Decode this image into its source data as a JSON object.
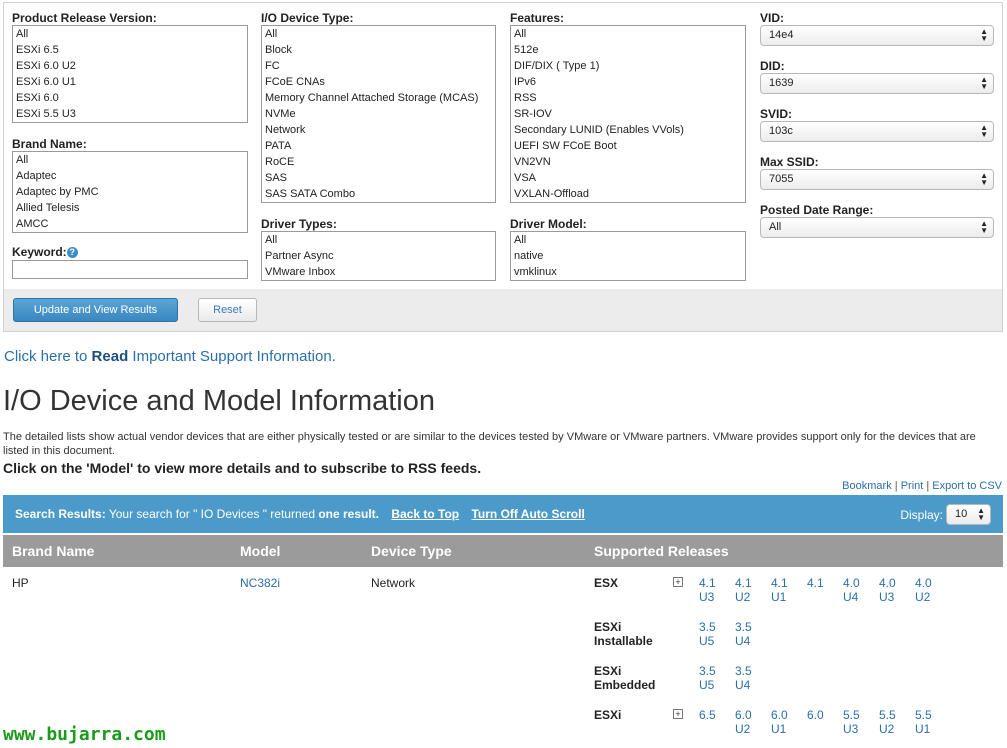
{
  "filters": {
    "product_release": {
      "label": "Product Release Version:",
      "options": [
        "All",
        "ESXi 6.5",
        "ESXi 6.0 U2",
        "ESXi 6.0 U1",
        "ESXi 6.0",
        "ESXi 5.5 U3"
      ]
    },
    "brand_name": {
      "label": "Brand Name:",
      "options": [
        "All",
        "Adaptec",
        "Adaptec by PMC",
        "Allied Telesis",
        "AMCC"
      ]
    },
    "keyword": {
      "label": "Keyword:",
      "help_icon": "help-icon",
      "value": ""
    },
    "io_device_type": {
      "label": "I/O Device Type:",
      "options": [
        "All",
        "Block",
        "FC",
        "FCoE CNAs",
        "Memory Channel Attached Storage (MCAS)",
        "NVMe",
        "Network",
        "PATA",
        "RoCE",
        "SAS",
        "SAS SATA Combo"
      ]
    },
    "driver_types": {
      "label": "Driver Types:",
      "options": [
        "All",
        "Partner Async",
        "VMware Inbox"
      ]
    },
    "features": {
      "label": "Features:",
      "options": [
        "All",
        "512e",
        "DIF/DIX ( Type 1)",
        "IPv6",
        "RSS",
        "SR-IOV",
        "Secondary LUNID (Enables VVols)",
        "UEFI SW FCoE Boot",
        "VN2VN",
        "VSA",
        "VXLAN-Offload"
      ]
    },
    "driver_model": {
      "label": "Driver Model:",
      "options": [
        "All",
        "native",
        "vmklinux"
      ]
    },
    "vid": {
      "label": "VID:",
      "value": "14e4"
    },
    "did": {
      "label": "DID:",
      "value": "1639"
    },
    "svid": {
      "label": "SVID:",
      "value": "103c"
    },
    "max_ssid": {
      "label": "Max SSID:",
      "value": "7055"
    },
    "posted_date": {
      "label": "Posted Date Range:",
      "value": "All"
    },
    "update_button": "Update and View Results",
    "reset_button": "Reset"
  },
  "support": {
    "prefix": "Click here to ",
    "bold": "Read",
    "suffix": " Important Support Information."
  },
  "page_title": "I/O Device and Model Information",
  "description": "The detailed lists show actual vendor devices that are either physically tested or are similar to the devices tested by VMware or VMware partners. VMware provides support only for the devices that are listed in this document.",
  "click_note": "Click on the 'Model' to view more details and to subscribe to RSS feeds.",
  "tool_links": {
    "bookmark": "Bookmark",
    "print": "Print",
    "export": "Export to CSV",
    "separator": "|"
  },
  "results": {
    "label": "Search Results:",
    "text_before": " Your search for \" IO Devices \" returned ",
    "count_text": "one result.",
    "back_to_top": "Back to Top",
    "auto_scroll": "Turn Off Auto Scroll",
    "display_label": "Display:",
    "display_value": "10"
  },
  "table": {
    "headers": {
      "brand": "Brand Name",
      "model": "Model",
      "device_type": "Device Type",
      "releases": "Supported Releases"
    },
    "row": {
      "brand": "HP",
      "model": "NC382i",
      "device_type": "Network",
      "release_groups": [
        {
          "name_line1": "ESX",
          "name_line2": "",
          "expandable": true,
          "versions": [
            [
              "4.1",
              "U3"
            ],
            [
              "4.1",
              "U2"
            ],
            [
              "4.1",
              "U1"
            ],
            [
              "4.1",
              ""
            ],
            [
              "4.0",
              "U4"
            ],
            [
              "4.0",
              "U3"
            ],
            [
              "4.0",
              "U2"
            ]
          ]
        },
        {
          "name_line1": "ESXi",
          "name_line2": "Installable",
          "expandable": false,
          "versions": [
            [
              "3.5",
              "U5"
            ],
            [
              "3.5",
              "U4"
            ]
          ]
        },
        {
          "name_line1": "ESXi",
          "name_line2": "Embedded",
          "expandable": false,
          "versions": [
            [
              "3.5",
              "U5"
            ],
            [
              "3.5",
              "U4"
            ]
          ]
        },
        {
          "name_line1": "ESXi",
          "name_line2": "",
          "expandable": true,
          "versions": [
            [
              "6.5",
              ""
            ],
            [
              "6.0",
              "U2"
            ],
            [
              "6.0",
              "U1"
            ],
            [
              "6.0",
              ""
            ],
            [
              "5.5",
              "U3"
            ],
            [
              "5.5",
              "U2"
            ],
            [
              "5.5",
              "U1"
            ]
          ]
        }
      ]
    }
  },
  "watermark": "www.bujarra.com"
}
